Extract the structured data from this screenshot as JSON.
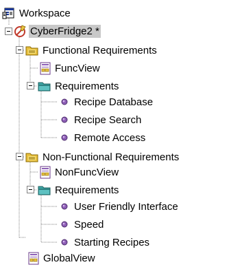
{
  "tree": {
    "workspace": {
      "label": "Workspace",
      "icon": "workspace-icon"
    },
    "project": {
      "label": "CyberFridge2 *",
      "icon": "project-icon",
      "selected": true
    },
    "functional": {
      "label": "Functional Requirements",
      "icon": "folder-yellow-icon",
      "view": {
        "label": "FuncView",
        "icon": "view-document-icon"
      },
      "requirements": {
        "label": "Requirements",
        "icon": "folder-teal-icon",
        "items": [
          "Recipe Database",
          "Recipe Search",
          "Remote Access"
        ]
      }
    },
    "nonfunctional": {
      "label": "Non-Functional Requirements",
      "icon": "folder-yellow-icon",
      "view": {
        "label": "NonFuncView",
        "icon": "view-document-icon"
      },
      "requirements": {
        "label": "Requirements",
        "icon": "folder-teal-icon",
        "items": [
          "User Friendly Interface",
          "Speed",
          "Starting Recipes"
        ]
      }
    },
    "global_view": {
      "label": "GlobalView",
      "icon": "view-document-icon"
    }
  },
  "colors": {
    "selection": "#c8c8c8",
    "requirement_bullet": "#8e5fb6",
    "folder_yellow": "#e8c040",
    "folder_teal": "#3ea7a7",
    "tree_lines": "#808080"
  }
}
